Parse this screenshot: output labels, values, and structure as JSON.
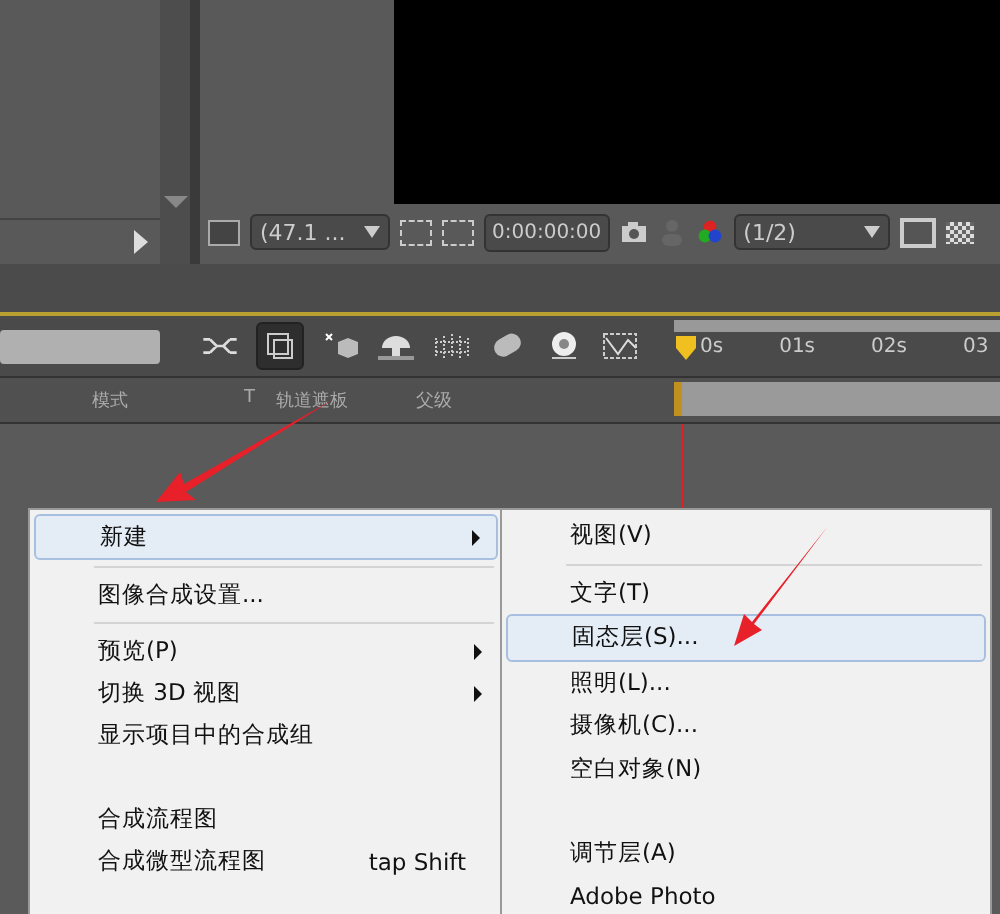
{
  "viewer_toolbar": {
    "zoom": "(47.1 ...",
    "timecode": "0:00:00:00",
    "resolution": "(1/2)"
  },
  "timeline": {
    "columns": [
      "模式",
      "T",
      "轨道遮板",
      "父级"
    ],
    "ruler": [
      "0s",
      "01s",
      "02s",
      "03"
    ]
  },
  "context_menu": {
    "items": [
      {
        "kind": "item",
        "label": "新建",
        "submenu": true,
        "selected": true
      },
      {
        "kind": "separator"
      },
      {
        "kind": "item",
        "label": "图像合成设置...",
        "submenu": false,
        "selected": false
      },
      {
        "kind": "separator"
      },
      {
        "kind": "item",
        "label": "预览(P)",
        "submenu": true,
        "selected": false
      },
      {
        "kind": "item",
        "label": "切换 3D 视图",
        "submenu": true,
        "selected": false
      },
      {
        "kind": "item",
        "label": "显示项目中的合成组",
        "submenu": false,
        "selected": false
      },
      {
        "kind": "gap"
      },
      {
        "kind": "item",
        "label": "合成流程图",
        "submenu": false,
        "selected": false
      },
      {
        "kind": "item",
        "label": "合成微型流程图",
        "shortcut": "tap Shift",
        "submenu": false,
        "selected": false
      }
    ]
  },
  "submenu": {
    "items": [
      {
        "kind": "item",
        "label": "视图(V)",
        "selected": false
      },
      {
        "kind": "separator"
      },
      {
        "kind": "item",
        "label": "文字(T)",
        "selected": false
      },
      {
        "kind": "item",
        "label": "固态层(S)...",
        "selected": true
      },
      {
        "kind": "item",
        "label": "照明(L)...",
        "selected": false
      },
      {
        "kind": "item",
        "label": "摄像机(C)...",
        "selected": false
      },
      {
        "kind": "item",
        "label": "空白对象(N)",
        "selected": false
      },
      {
        "kind": "gap"
      },
      {
        "kind": "item",
        "label": "调节层(A)",
        "selected": false
      },
      {
        "kind": "item",
        "label": "Adobe Photo",
        "selected": false
      }
    ]
  }
}
